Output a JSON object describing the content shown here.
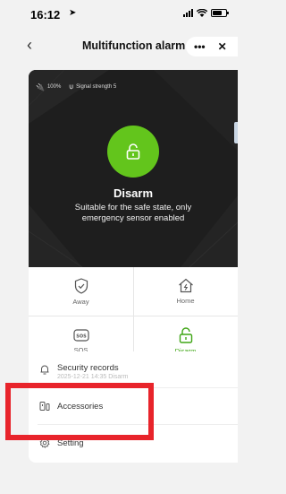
{
  "status_bar": {
    "time": "16:12",
    "location_arrow": "➤"
  },
  "nav": {
    "title": "Multifunction alarm",
    "back_icon": "‹",
    "more_icon": "•••",
    "close_icon": "✕"
  },
  "hero": {
    "battery_text": "100%",
    "signal_text": "Signal strength 5",
    "mode_title": "Disarm",
    "mode_description": "Suitable for the safe state, only emergency sensor enabled",
    "accent_color": "#63c51c",
    "background_color": "#1e1e1e"
  },
  "modes": [
    {
      "label": "Away",
      "icon": "shield-check-icon",
      "active": false
    },
    {
      "label": "Home",
      "icon": "home-bolt-icon",
      "active": false
    },
    {
      "label": "SOS",
      "icon": "sos-icon",
      "active": false
    },
    {
      "label": "Disarm",
      "icon": "unlock-icon",
      "active": true
    }
  ],
  "list": {
    "security_records": {
      "label": "Security records",
      "subtitle": "2025-12-21 14:35 Disarm"
    },
    "accessories": {
      "label": "Accessories"
    },
    "setting": {
      "label": "Setting"
    }
  },
  "highlight_color": "#e8242b"
}
